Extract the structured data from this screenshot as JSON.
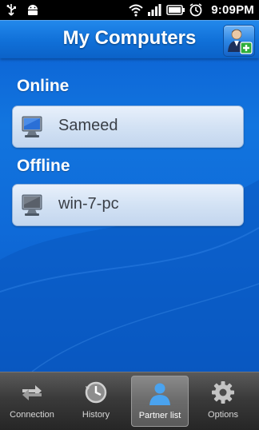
{
  "status_bar": {
    "time": "9:09PM",
    "icons": [
      "usb-icon",
      "android-debug-icon",
      "wifi-icon",
      "signal-icon",
      "battery-icon",
      "alarm-icon"
    ]
  },
  "header": {
    "title": "My Computers",
    "action_icon": "add-contact-icon"
  },
  "sections": {
    "online": {
      "heading": "Online",
      "computers": [
        {
          "name": "Sameed",
          "status": "online"
        }
      ]
    },
    "offline": {
      "heading": "Offline",
      "computers": [
        {
          "name": "win-7-pc",
          "status": "offline"
        }
      ]
    }
  },
  "tabs": [
    {
      "label": "Connection",
      "icon": "connection-arrows-icon",
      "active": false
    },
    {
      "label": "History",
      "icon": "history-clock-icon",
      "active": false
    },
    {
      "label": "Partner list",
      "icon": "partner-person-icon",
      "active": true
    },
    {
      "label": "Options",
      "icon": "gear-icon",
      "active": false
    }
  ],
  "colors": {
    "background_blue": "#0f6ad8",
    "row_fill": "#d3e2f4",
    "tab_bar": "#3a3a3a"
  }
}
